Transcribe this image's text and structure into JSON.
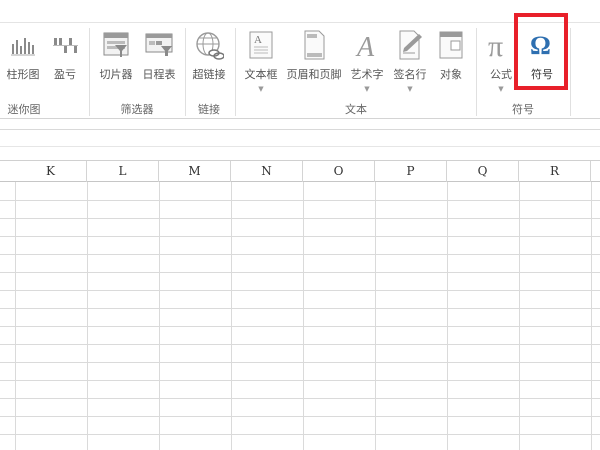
{
  "ribbon": {
    "buttons": [
      {
        "label": "柱形图",
        "icon": "column-sparkline-icon"
      },
      {
        "label": "盈亏",
        "icon": "win-loss-sparkline-icon"
      },
      {
        "label": "切片器",
        "icon": "slicer-icon"
      },
      {
        "label": "日程表",
        "icon": "timeline-icon"
      },
      {
        "label": "超链接",
        "icon": "hyperlink-icon"
      },
      {
        "label": "文本框",
        "icon": "textbox-icon"
      },
      {
        "label": "页眉和页脚",
        "icon": "header-footer-icon"
      },
      {
        "label": "艺术字",
        "icon": "wordart-icon"
      },
      {
        "label": "签名行",
        "icon": "signature-line-icon"
      },
      {
        "label": "对象",
        "icon": "object-icon"
      },
      {
        "label": "公式",
        "icon": "equation-icon"
      },
      {
        "label": "符号",
        "icon": "symbol-icon"
      }
    ],
    "groups": {
      "sparklines": "迷你图",
      "filters": "筛选器",
      "links": "链接",
      "text": "文本",
      "symbols": "符号"
    },
    "highlight_color": "#e8202a",
    "symbol_icon_color": "#2e6fb0"
  },
  "sheet": {
    "columns": [
      "K",
      "L",
      "M",
      "N",
      "O",
      "P",
      "Q",
      "R"
    ]
  }
}
